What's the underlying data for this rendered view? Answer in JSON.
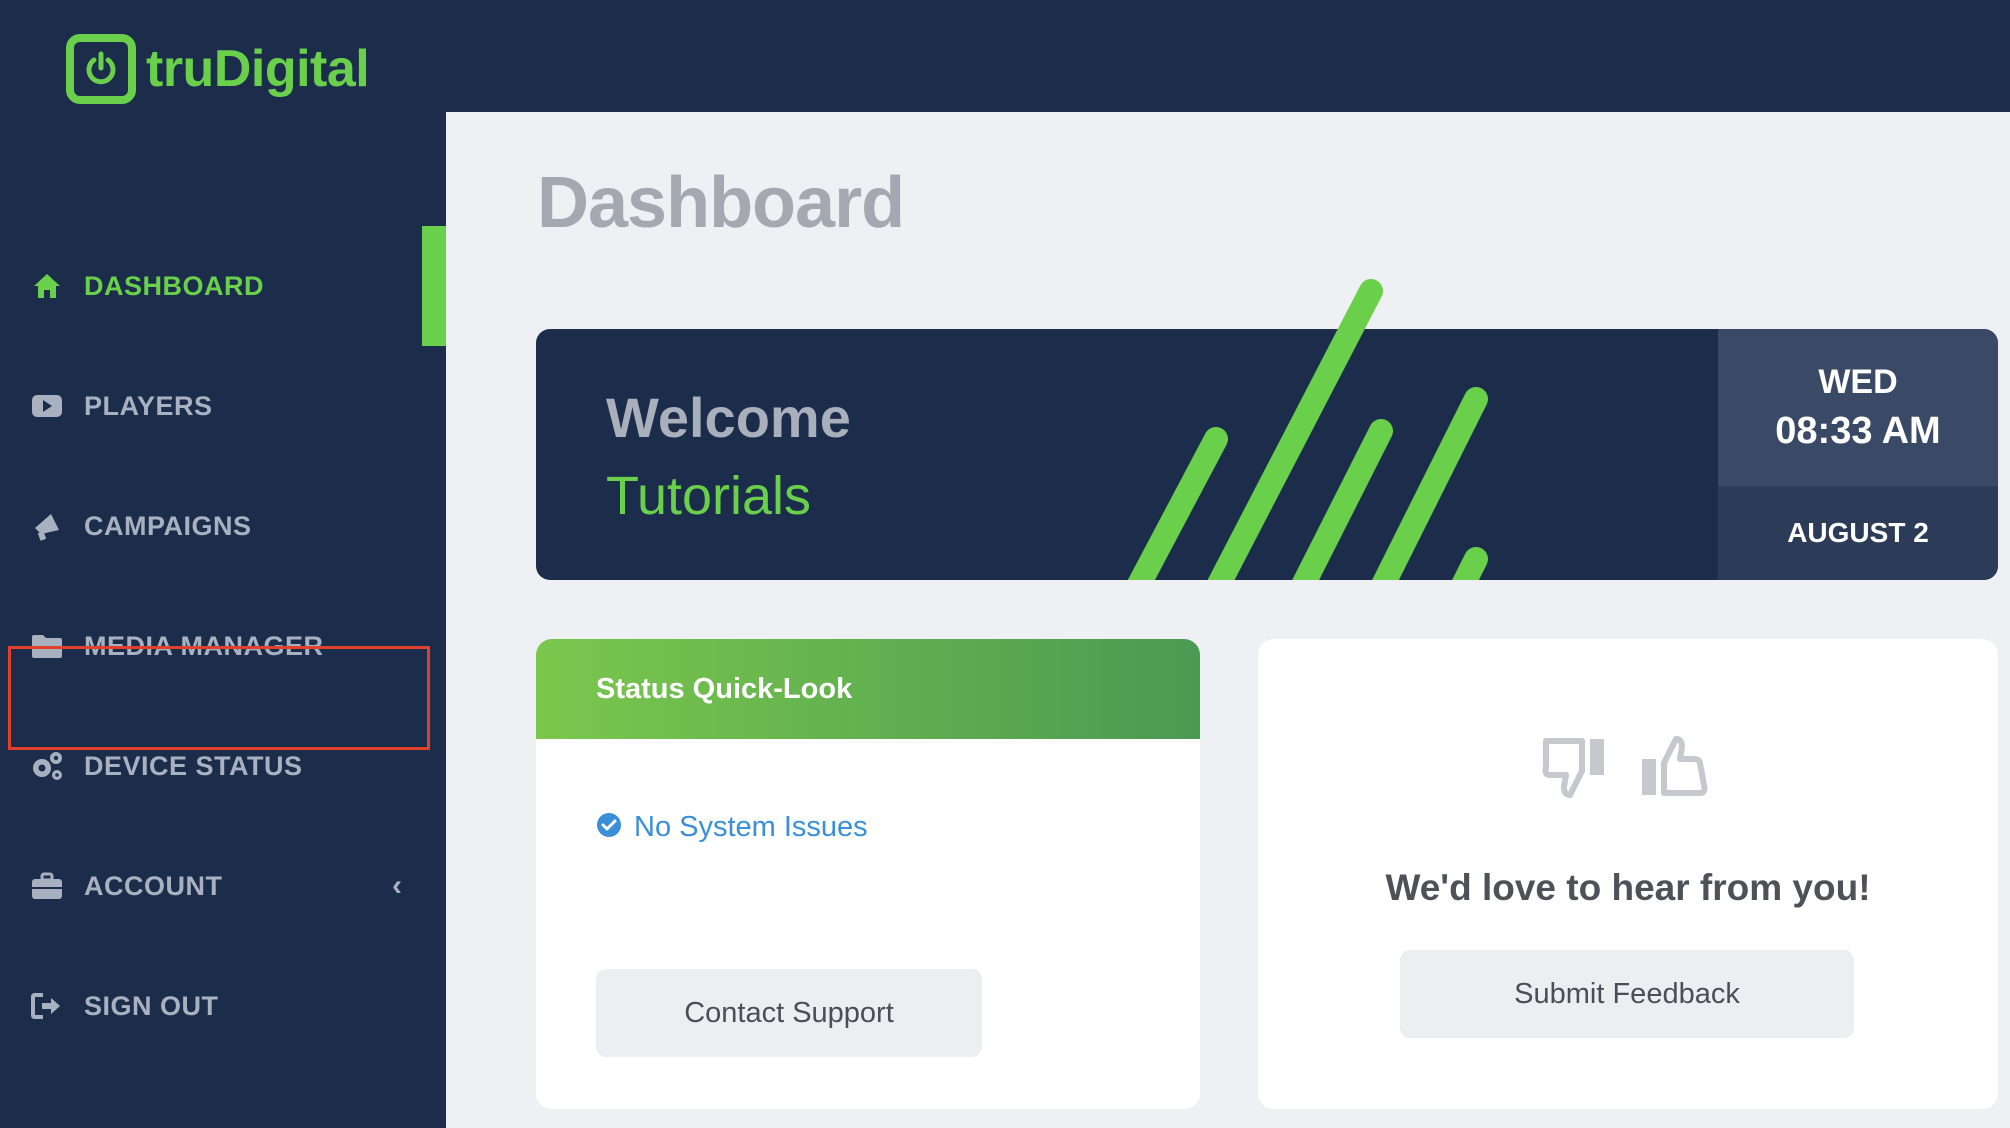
{
  "brand": {
    "name": "truDigital",
    "color": "#6ad04b"
  },
  "sidebar": {
    "items": [
      {
        "label": "DASHBOARD",
        "icon": "home-icon",
        "active": true
      },
      {
        "label": "PLAYERS",
        "icon": "play-icon"
      },
      {
        "label": "CAMPAIGNS",
        "icon": "megaphone-icon"
      },
      {
        "label": "MEDIA MANAGER",
        "icon": "folder-icon",
        "highlighted": true
      },
      {
        "label": "DEVICE STATUS",
        "icon": "gears-icon"
      },
      {
        "label": "ACCOUNT",
        "icon": "briefcase-icon",
        "expandable": true
      },
      {
        "label": "SIGN OUT",
        "icon": "sign-out-icon"
      }
    ]
  },
  "main": {
    "title": "Dashboard",
    "welcome": {
      "title": "Welcome",
      "subtitle": "Tutorials"
    },
    "date": {
      "day": "WED",
      "time": "08:33 AM",
      "date": "AUGUST 2"
    },
    "status_card": {
      "header": "Status Quick-Look",
      "status": "No System Issues",
      "button": "Contact Support"
    },
    "feedback_card": {
      "message": "We'd love to hear from you!",
      "button": "Submit Feedback"
    }
  },
  "colors": {
    "sidebar_bg": "#1b2d4b",
    "accent": "#6ad04b",
    "highlight_border": "#e2402a",
    "status_link": "#3a8fd8"
  }
}
